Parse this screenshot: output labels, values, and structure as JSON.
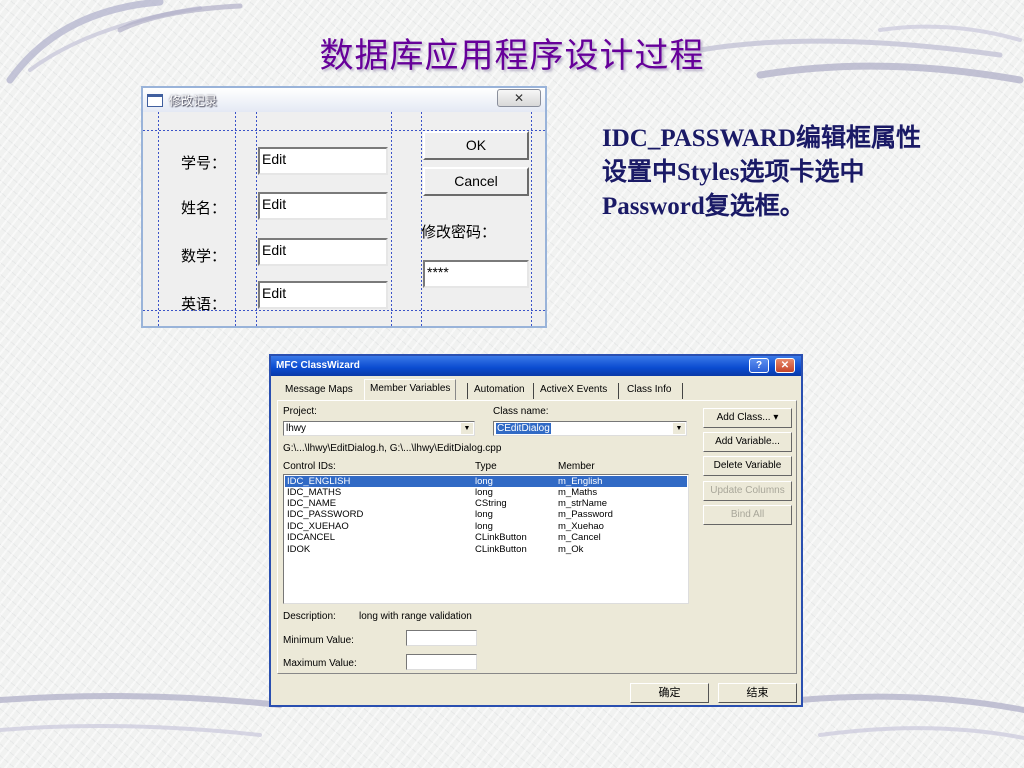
{
  "slide": {
    "title": "数据库应用程序设计过程",
    "note": "IDC_PASSWARD编辑框属性设置中Styles选项卡选中Password复选框。"
  },
  "dialog_edit": {
    "title": "修改记录",
    "close_glyph": "✕",
    "fields": [
      {
        "label": "学号：",
        "value": "Edit"
      },
      {
        "label": "姓名：",
        "value": "Edit"
      },
      {
        "label": "数学：",
        "value": "Edit"
      },
      {
        "label": "英语：",
        "value": "Edit"
      }
    ],
    "ok_label": "OK",
    "cancel_label": "Cancel",
    "password_label": "修改密码：",
    "password_value": "****"
  },
  "class_wizard": {
    "title": "MFC ClassWizard",
    "help_glyph": "?",
    "close_glyph": "✕",
    "tabs": [
      "Message Maps",
      "Member Variables",
      "Automation",
      "ActiveX Events",
      "Class Info"
    ],
    "project_label": "Project:",
    "project_value": "lhwy",
    "class_name_label": "Class name:",
    "class_name_value": "CEditDialog",
    "files_path": "G:\\...\\lhwy\\EditDialog.h, G:\\...\\lhwy\\EditDialog.cpp",
    "columns": {
      "id": "Control IDs:",
      "type": "Type",
      "member": "Member"
    },
    "rows": [
      {
        "id": "IDC_ENGLISH",
        "type": "long",
        "member": "m_English"
      },
      {
        "id": "IDC_MATHS",
        "type": "long",
        "member": "m_Maths"
      },
      {
        "id": "IDC_NAME",
        "type": "CString",
        "member": "m_strName"
      },
      {
        "id": "IDC_PASSWORD",
        "type": "long",
        "member": "m_Password"
      },
      {
        "id": "IDC_XUEHAO",
        "type": "long",
        "member": "m_Xuehao"
      },
      {
        "id": "IDCANCEL",
        "type": "CLinkButton",
        "member": "m_Cancel"
      },
      {
        "id": "IDOK",
        "type": "CLinkButton",
        "member": "m_Ok"
      }
    ],
    "buttons": {
      "add_class": "Add Class...  ▾",
      "add_variable": "Add Variable...",
      "delete_variable": "Delete Variable",
      "update_columns": "Update Columns",
      "bind_all": "Bind All"
    },
    "description_label": "Description:",
    "description_value": "long with range validation",
    "min_label": "Minimum Value:",
    "max_label": "Maximum Value:",
    "confirm": "确定",
    "end": "结束"
  },
  "colors": {
    "title": "#660099",
    "note": "#1a1a66",
    "selection": "#316ac5",
    "xp_titlebar": "#0a4bd0"
  }
}
